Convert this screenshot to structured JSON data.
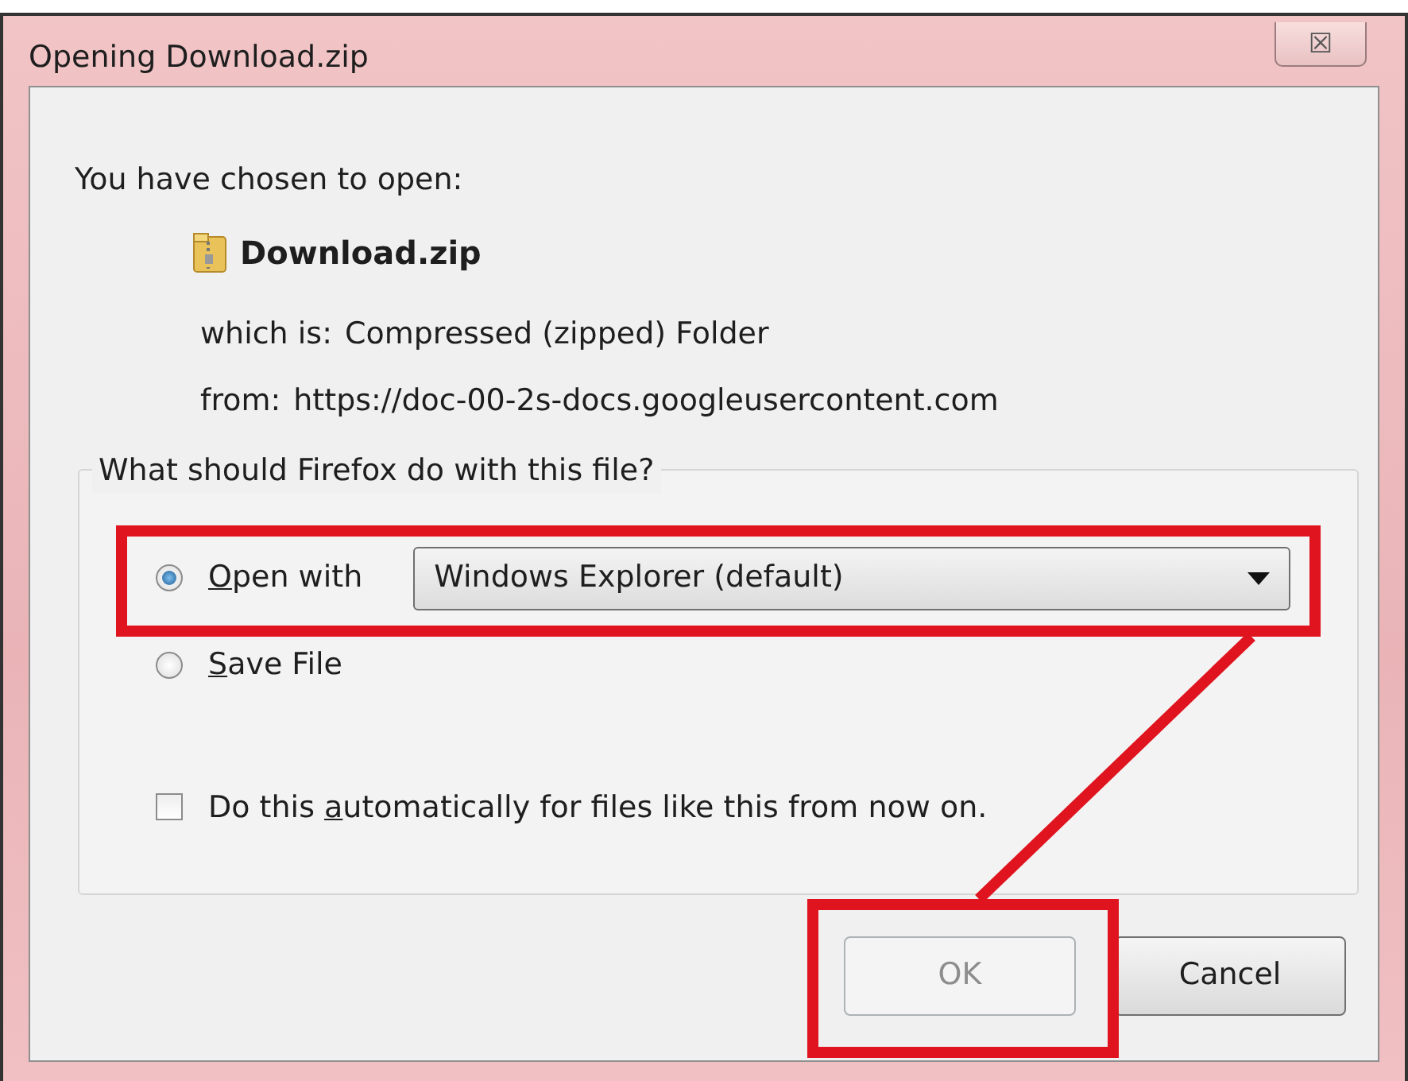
{
  "window": {
    "title": "Opening Download.zip",
    "close_symbol": "☒"
  },
  "intro": "You have chosen to open:",
  "file": {
    "name": "Download.zip"
  },
  "details": [
    {
      "label": "which is:",
      "value": "Compressed (zipped) Folder"
    },
    {
      "label": "from:",
      "value": "https://doc-00-2s-docs.googleusercontent.com"
    }
  ],
  "group": {
    "legend": "What should Firefox do with this file?",
    "options": [
      {
        "kind": "radio-select",
        "key": "O",
        "after": "pen with",
        "selected": true,
        "highlighted": true,
        "select_value": "Windows Explorer (default)"
      },
      {
        "kind": "radio",
        "key": "S",
        "after": "ave File",
        "selected": false,
        "highlighted": false
      }
    ],
    "checkbox": {
      "before": "Do this ",
      "key": "a",
      "after": "utomatically for files like this from now on.",
      "checked": false
    }
  },
  "buttons": [
    {
      "label": "OK",
      "disabled": true,
      "highlighted": true
    },
    {
      "label": "Cancel",
      "disabled": false,
      "highlighted": false
    }
  ],
  "connector": true
}
